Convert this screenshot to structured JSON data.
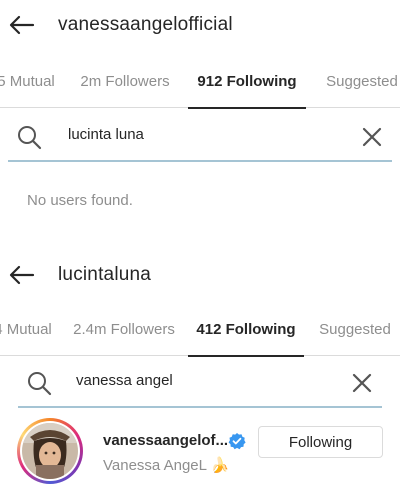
{
  "panel_top": {
    "header": {
      "back_icon": "arrow-left-icon",
      "title": "vanessaangelofficial"
    },
    "tabs": [
      {
        "label": "5 Mutual",
        "active": false
      },
      {
        "label": "2m Followers",
        "active": false
      },
      {
        "label": "912 Following",
        "active": true
      },
      {
        "label": "Suggested",
        "active": false
      }
    ],
    "search": {
      "icon": "search-icon",
      "value": "lucinta luna",
      "clear_icon": "close-icon"
    },
    "empty_message": "No users found."
  },
  "panel_bottom": {
    "header": {
      "back_icon": "arrow-left-icon",
      "title": "lucintaluna"
    },
    "tabs": [
      {
        "label": "4 Mutual",
        "active": false
      },
      {
        "label": "2.4m Followers",
        "active": false
      },
      {
        "label": "412 Following",
        "active": true
      },
      {
        "label": "Suggested",
        "active": false
      }
    ],
    "search": {
      "icon": "search-icon",
      "value": "vanessa angel",
      "clear_icon": "close-icon"
    },
    "results": [
      {
        "username": "vanessaangelof...",
        "verified": true,
        "full_name": "Vanessa AngeL 🍌",
        "button_label": "Following",
        "has_story_ring": true
      }
    ]
  },
  "colors": {
    "active_tab": "#262626",
    "inactive_tab": "#8e8e8e",
    "search_underline": "#a5c4d4",
    "verified_badge": "#3897f0"
  }
}
